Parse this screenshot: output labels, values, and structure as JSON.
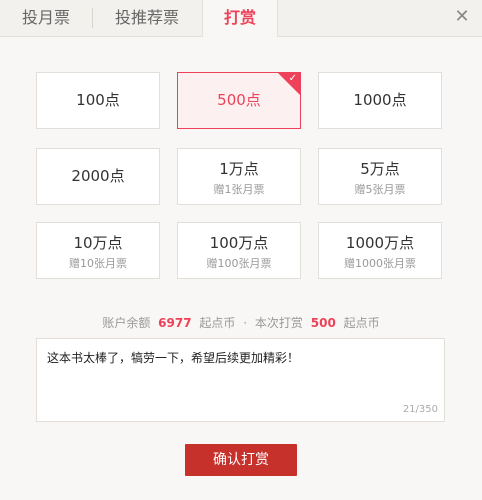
{
  "tabs": [
    {
      "label": "投月票"
    },
    {
      "label": "投推荐票"
    },
    {
      "label": "打赏"
    }
  ],
  "close_symbol": "✕",
  "options": [
    {
      "amount": "100点",
      "sub": ""
    },
    {
      "amount": "500点",
      "sub": "",
      "selected": true
    },
    {
      "amount": "1000点",
      "sub": ""
    },
    {
      "amount": "2000点",
      "sub": ""
    },
    {
      "amount": "1万点",
      "sub": "赠1张月票"
    },
    {
      "amount": "5万点",
      "sub": "赠5张月票"
    },
    {
      "amount": "10万点",
      "sub": "赠10张月票"
    },
    {
      "amount": "100万点",
      "sub": "赠100张月票"
    },
    {
      "amount": "1000万点",
      "sub": "赠1000张月票"
    }
  ],
  "balance": {
    "label1": "账户余额",
    "balance_value": "6977",
    "unit1": "起点币",
    "sep": "·",
    "label2": "本次打赏",
    "tip_value": "500",
    "unit2": "起点币"
  },
  "message": {
    "text": "这本书太棒了，犒劳一下，希望后续更加精彩！",
    "counter": "21/350"
  },
  "confirm_label": "确认打赏",
  "colors": {
    "accent": "#ed4259",
    "button": "#c7312b"
  }
}
